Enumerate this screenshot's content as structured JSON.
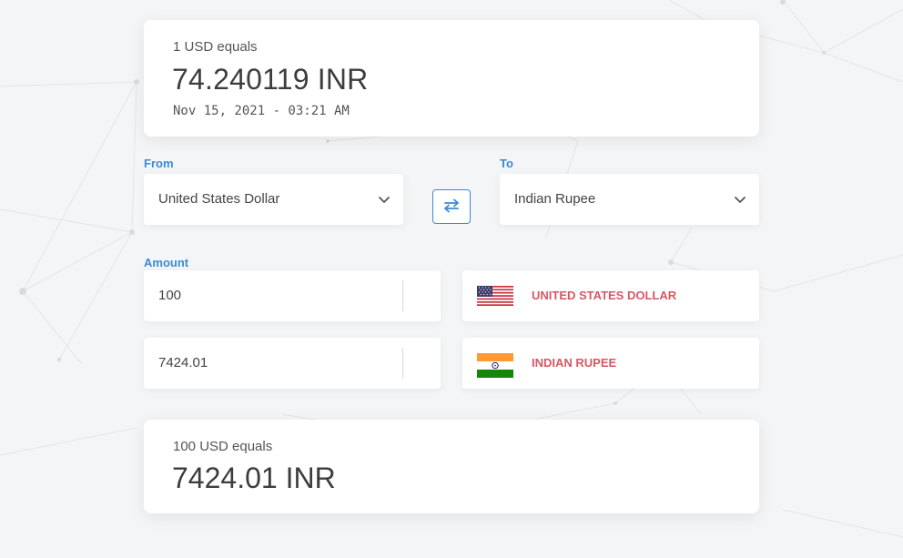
{
  "rate_card": {
    "caption": "1 USD equals",
    "rate_text": "74.240119 INR",
    "timestamp": "Nov 15, 2021 - 03:21 AM"
  },
  "from": {
    "label": "From",
    "selected": "United States Dollar"
  },
  "to": {
    "label": "To",
    "selected": "Indian Rupee"
  },
  "swap_icon": "swap-arrows-icon",
  "amount": {
    "label": "Amount",
    "from_value": "100",
    "to_value": "7424.01",
    "from_currency_name": "UNITED STATES DOLLAR",
    "to_currency_name": "INDIAN RUPEE",
    "from_flag": "us-flag-icon",
    "to_flag": "india-flag-icon"
  },
  "result_card": {
    "caption": "100 USD equals",
    "result_text": "7424.01 INR"
  },
  "colors": {
    "accent": "#3a8ad6",
    "currency_name": "#d75763",
    "background": "#f4f5f7"
  }
}
